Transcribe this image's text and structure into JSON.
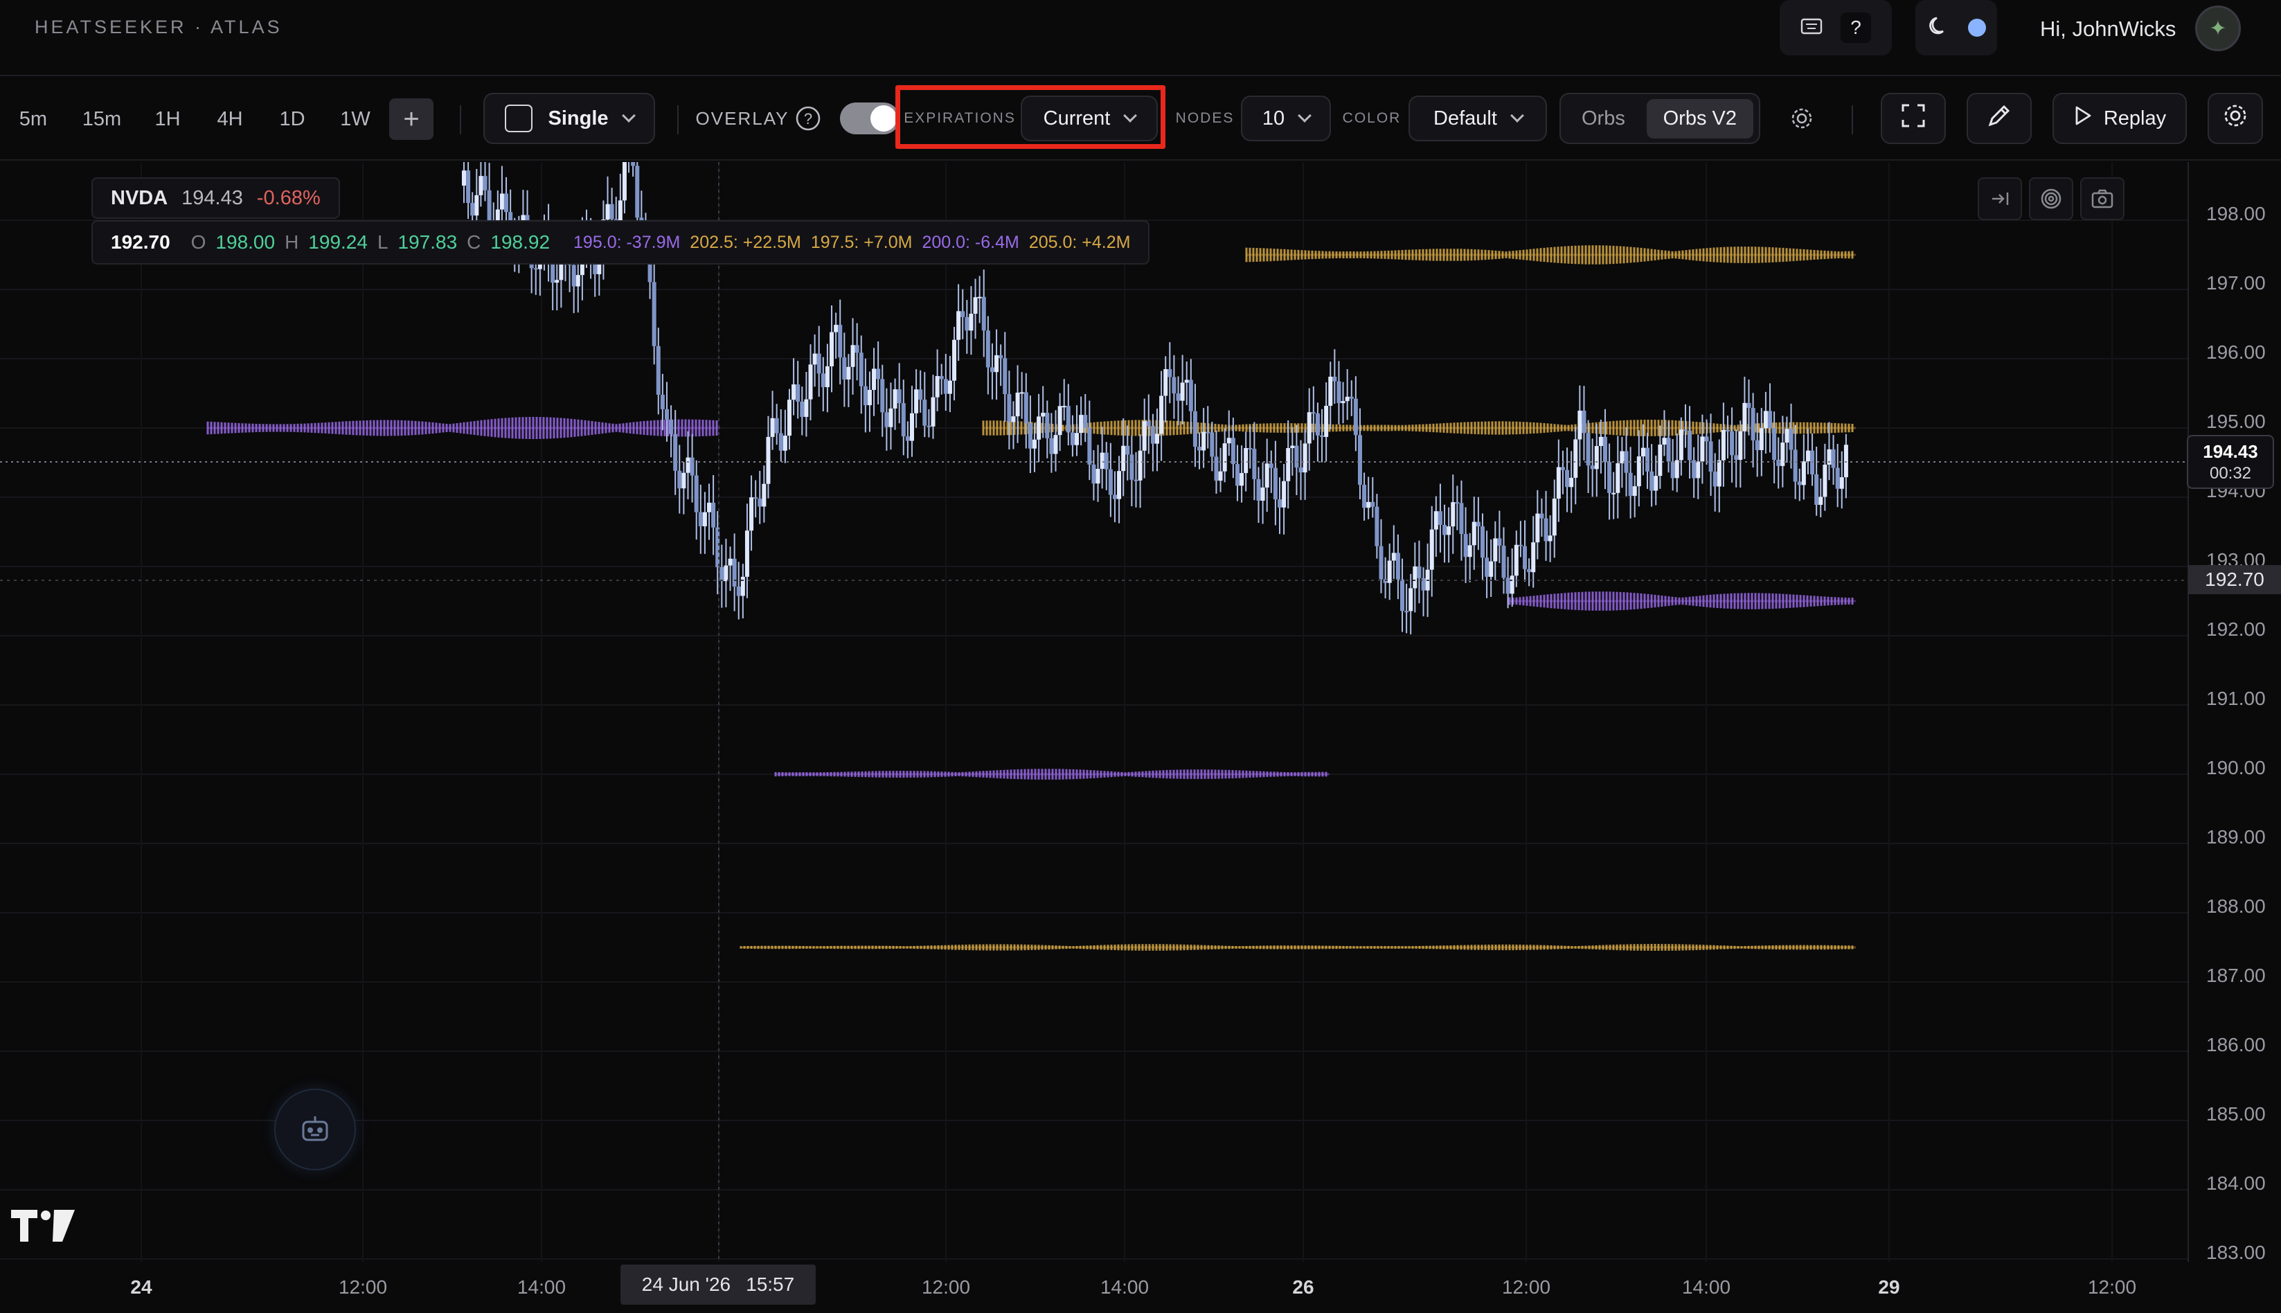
{
  "brand": "HEATSEEKER · ATLAS",
  "header": {
    "help_label": "?",
    "greeting": "Hi, JohnWicks"
  },
  "toolbar": {
    "timeframes": [
      "5m",
      "15m",
      "1H",
      "4H",
      "1D",
      "1W"
    ],
    "add_label": "+",
    "mode_label": "Single",
    "overlay_label": "OVERLAY",
    "overlay_enabled": true,
    "expirations_label": "EXPIRATIONS",
    "expirations_value": "Current",
    "nodes_label": "NODES",
    "nodes_value": "10",
    "color_label": "COLOR",
    "color_value": "Default",
    "view_options": [
      "Orbs",
      "Orbs V2"
    ],
    "view_selected": "Orbs V2",
    "replay_label": "Replay"
  },
  "legend": {
    "symbol": "NVDA",
    "price": "194.43",
    "change": "-0.68%",
    "cursor_price": "192.70",
    "o_label": "O",
    "open": "198.00",
    "h_label": "H",
    "high": "199.24",
    "l_label": "L",
    "low": "197.83",
    "c_label": "C",
    "close": "198.92",
    "nodes": [
      {
        "text": "195.0: -37.9M",
        "color": "#9a6ae8"
      },
      {
        "text": "202.5: +22.5M",
        "color": "#d8a945"
      },
      {
        "text": "197.5: +7.0M",
        "color": "#d8a945"
      },
      {
        "text": "200.0: -6.4M",
        "color": "#9a6ae8"
      },
      {
        "text": "205.0: +4.2M",
        "color": "#d8a945"
      }
    ]
  },
  "axis": {
    "price_ticks": [
      "198.00",
      "197.00",
      "196.00",
      "195.00",
      "194.00",
      "193.00",
      "192.00",
      "191.00",
      "190.00",
      "189.00",
      "188.00",
      "187.00",
      "186.00",
      "185.00",
      "184.00",
      "183.00"
    ],
    "time_ticks": [
      {
        "label": "24",
        "bold": true
      },
      {
        "label": "12:00",
        "bold": false
      },
      {
        "label": "14:00",
        "bold": false
      },
      {
        "label": "12:00",
        "bold": false
      },
      {
        "label": "14:00",
        "bold": false
      },
      {
        "label": "26",
        "bold": true
      },
      {
        "label": "12:00",
        "bold": false
      },
      {
        "label": "14:00",
        "bold": false
      },
      {
        "label": "29",
        "bold": true
      },
      {
        "label": "12:00",
        "bold": false
      }
    ],
    "current_price": "194.43",
    "countdown": "00:32",
    "crosshair_price": "192.70",
    "crosshair_date": "24 Jun '26",
    "crosshair_time": "15:57"
  },
  "colors": {
    "positive_node": "#d8a945",
    "negative_node": "#9a6ae8",
    "candle": "#aebfe6",
    "highlight": "#e8281c"
  },
  "chart_data": {
    "type": "candlestick",
    "symbol": "NVDA",
    "ylim": [
      182.8,
      198.6
    ],
    "heat_bands": [
      {
        "price": 197.5,
        "sign": "positive"
      },
      {
        "price": 195.0,
        "sign": "negative"
      },
      {
        "price": 195.0,
        "sign": "positive"
      },
      {
        "price": 192.5,
        "sign": "negative"
      },
      {
        "price": 190.0,
        "sign": "negative"
      },
      {
        "price": 187.5,
        "sign": "positive"
      }
    ],
    "approx_closes": [
      198.5,
      198.1,
      197.6,
      197.3,
      197.6,
      198.9,
      194.8,
      193.9,
      192.6,
      194.7,
      195.5,
      196.2,
      195.6,
      195.1,
      195.4,
      196.9,
      195.5,
      194.9,
      195.1,
      194.2,
      194.6,
      195.8,
      194.6,
      194.5,
      194.1,
      194.9,
      195.7,
      193.2,
      192.5,
      193.8,
      193.3,
      192.9,
      193.6,
      194.9,
      194.3,
      194.4,
      194.7,
      194.5,
      195.1,
      194.7,
      194.2,
      194.6
    ]
  }
}
